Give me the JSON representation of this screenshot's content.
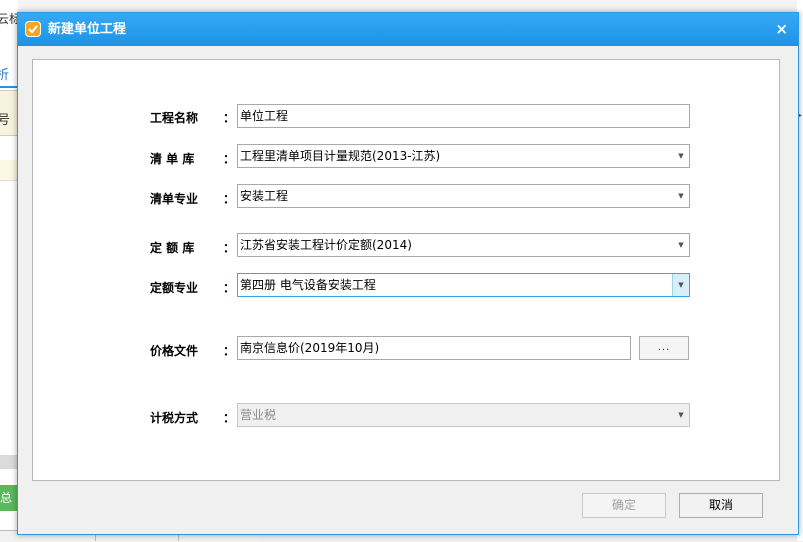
{
  "background": {
    "top_fragment": "云标",
    "tab_fragment": "析",
    "row_fragment": "号",
    "green_button_fragment": "总表"
  },
  "dialog": {
    "title": "新建单位工程",
    "close": "×"
  },
  "form": {
    "project_name": {
      "label": "工程名称",
      "value": "单位工程"
    },
    "bill_library": {
      "label": "清 单 库",
      "value": "工程里清单项目计量规范(2013-江苏)"
    },
    "bill_specialty": {
      "label": "清单专业",
      "value": "安装工程"
    },
    "quota_library": {
      "label": "定 额 库",
      "value": "江苏省安装工程计价定额(2014)"
    },
    "quota_specialty": {
      "label": "定额专业",
      "value": "第四册 电气设备安装工程"
    },
    "price_file": {
      "label": "价格文件",
      "value": "南京信息价(2019年10月)",
      "browse": "..."
    },
    "tax_method": {
      "label": "计税方式",
      "value": "营业税"
    },
    "colon": "："
  },
  "buttons": {
    "ok": "确定",
    "cancel": "取消"
  },
  "colors": {
    "titlebar": "#1d93e6",
    "focus_border": "#33aadd"
  }
}
